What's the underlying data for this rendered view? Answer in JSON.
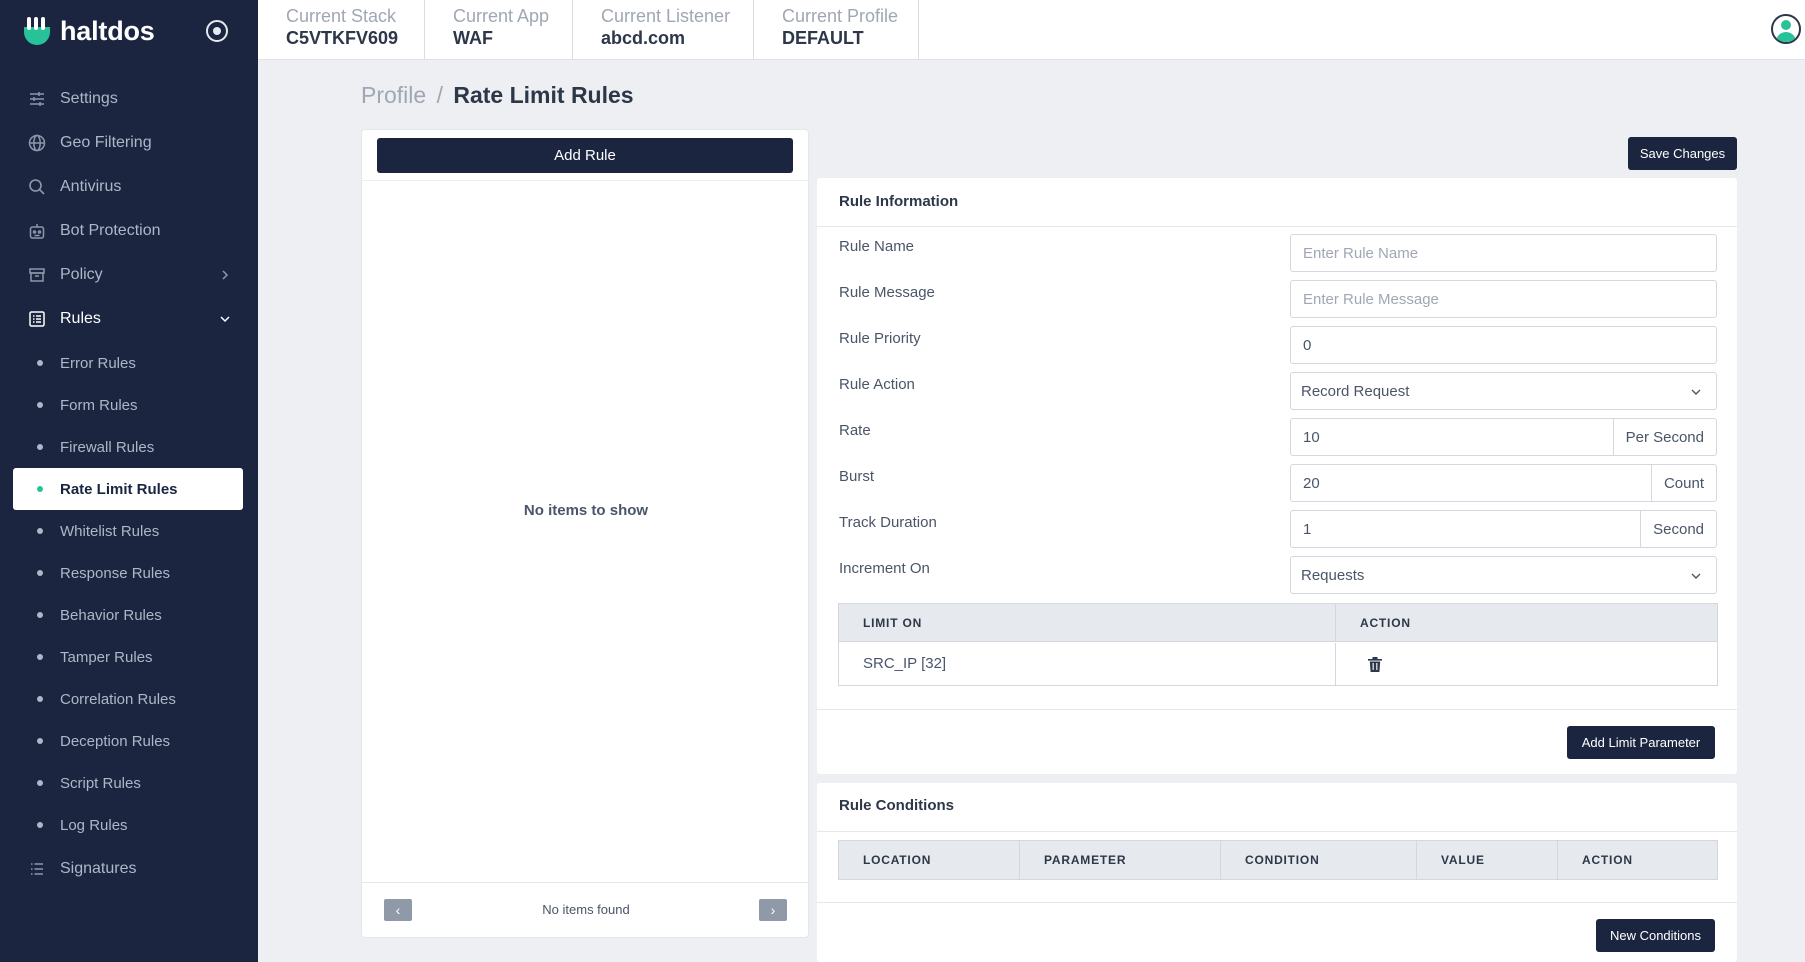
{
  "brand": {
    "name": "haltdos"
  },
  "context": [
    {
      "label": "Current Stack",
      "value": "C5VTKFV609"
    },
    {
      "label": "Current App",
      "value": "WAF"
    },
    {
      "label": "Current Listener",
      "value": "abcd.com"
    },
    {
      "label": "Current Profile",
      "value": "DEFAULT"
    }
  ],
  "sidebar": {
    "items": [
      {
        "label": "Settings",
        "icon": "sliders-icon"
      },
      {
        "label": "Geo Filtering",
        "icon": "globe-icon"
      },
      {
        "label": "Antivirus",
        "icon": "search-icon"
      },
      {
        "label": "Bot Protection",
        "icon": "robot-icon"
      },
      {
        "label": "Policy",
        "icon": "archive-icon"
      },
      {
        "label": "Rules",
        "icon": "list-icon"
      },
      {
        "label": "Signatures",
        "icon": "list-lines-icon"
      }
    ],
    "rules_sub": [
      "Error Rules",
      "Form Rules",
      "Firewall Rules",
      "Rate Limit Rules",
      "Whitelist Rules",
      "Response Rules",
      "Behavior Rules",
      "Tamper Rules",
      "Correlation Rules",
      "Deception Rules",
      "Script Rules",
      "Log Rules"
    ],
    "active_sub": "Rate Limit Rules"
  },
  "breadcrumb": {
    "root": "Profile",
    "separator": "/",
    "current": "Rate Limit Rules"
  },
  "left_panel": {
    "add_rule_label": "Add Rule",
    "empty_message": "No items to show",
    "pager_info": "No items found",
    "prev_symbol": "‹",
    "next_symbol": "›"
  },
  "save_label": "Save Changes",
  "rule_info": {
    "title": "Rule Information",
    "fields": {
      "rule_name": {
        "label": "Rule Name",
        "placeholder": "Enter Rule Name",
        "value": ""
      },
      "rule_message": {
        "label": "Rule Message",
        "placeholder": "Enter Rule Message",
        "value": ""
      },
      "rule_priority": {
        "label": "Rule Priority",
        "value": "0"
      },
      "rule_action": {
        "label": "Rule Action",
        "value": "Record Request"
      },
      "rate": {
        "label": "Rate",
        "value": "10",
        "unit": "Per Second"
      },
      "burst": {
        "label": "Burst",
        "value": "20",
        "unit": "Count"
      },
      "track_duration": {
        "label": "Track Duration",
        "value": "1",
        "unit": "Second"
      },
      "increment_on": {
        "label": "Increment On",
        "value": "Requests"
      }
    },
    "limit_table": {
      "headers": [
        "LIMIT ON",
        "ACTION"
      ],
      "rows": [
        {
          "limit_on": "SRC_IP [32]"
        }
      ]
    },
    "add_param_label": "Add Limit Parameter"
  },
  "rule_conditions": {
    "title": "Rule Conditions",
    "headers": [
      "LOCATION",
      "PARAMETER",
      "CONDITION",
      "VALUE",
      "ACTION"
    ],
    "new_label": "New Conditions"
  },
  "colors": {
    "sidebar_bg": "#1b2540",
    "accent": "#27c29a",
    "page_bg": "#edeff2"
  }
}
